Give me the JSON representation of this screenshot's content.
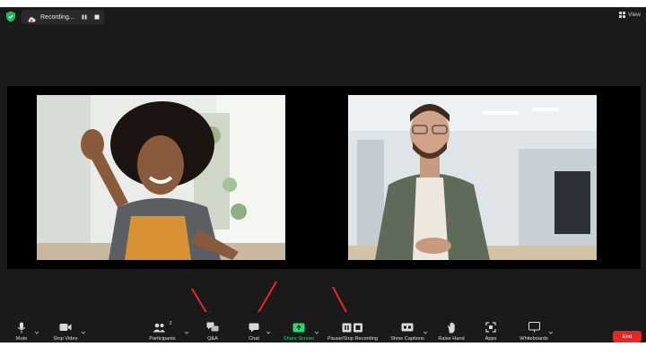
{
  "topbar": {
    "recording_label": "Recording...",
    "view_label": "View"
  },
  "toolbar": {
    "mute": "Mute",
    "stop_video": "Stop Video",
    "participants": "Participants",
    "participants_count": "2",
    "qa": "Q&A",
    "chat": "Chat",
    "share_screen": "Share Screen",
    "pause_stop_recording": "Pause/Stop Recording",
    "show_captions": "Show Captions",
    "raise_hand": "Raise Hand",
    "apps": "Apps",
    "whiteboards": "Whiteboards",
    "end": "End"
  },
  "colors": {
    "background": "#1a1a1a",
    "share_green": "#2ed67a",
    "end_red": "#e02828",
    "arrow_red": "#e8262a",
    "shield_green": "#1fb85a"
  }
}
